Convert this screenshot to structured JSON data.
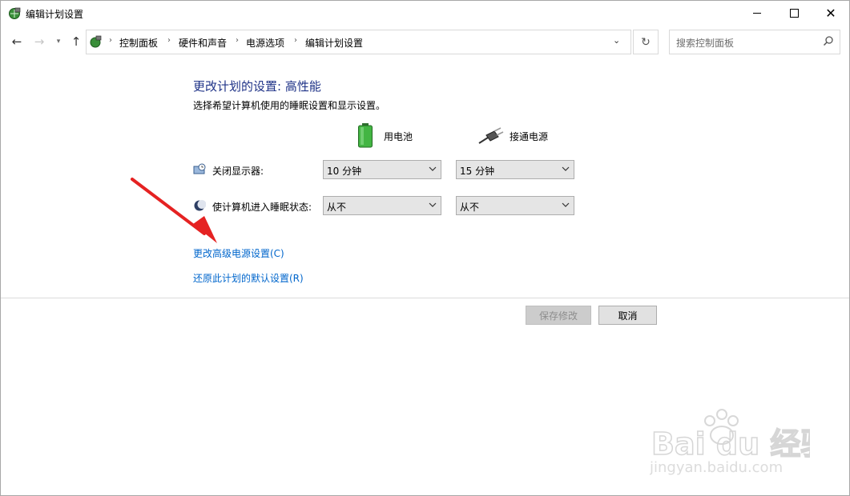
{
  "window": {
    "title": "编辑计划设置",
    "controls": [
      "minimize-icon",
      "maximize-icon",
      "close-icon"
    ]
  },
  "address": {
    "breadcrumbs": [
      "控制面板",
      "硬件和声音",
      "电源选项",
      "编辑计划设置"
    ],
    "search_placeholder": "搜索控制面板"
  },
  "content": {
    "heading": "更改计划的设置: 高性能",
    "description": "选择希望计算机使用的睡眠设置和显示设置。",
    "columns": {
      "battery": "用电池",
      "plugged": "接通电源"
    },
    "rows": [
      {
        "label": "关闭显示器:",
        "battery": "10 分钟",
        "plugged": "15 分钟",
        "icon": "monitor-clock-icon"
      },
      {
        "label": "使计算机进入睡眠状态:",
        "battery": "从不",
        "plugged": "从不",
        "icon": "moon-sleep-icon"
      }
    ],
    "links": {
      "advanced": "更改高级电源设置(C)",
      "restore": "还原此计划的默认设置(R)"
    }
  },
  "buttons": {
    "save": "保存修改",
    "cancel": "取消"
  },
  "watermark": {
    "brand": "Bai du 经验",
    "url": "jingyan.baidu.com"
  }
}
